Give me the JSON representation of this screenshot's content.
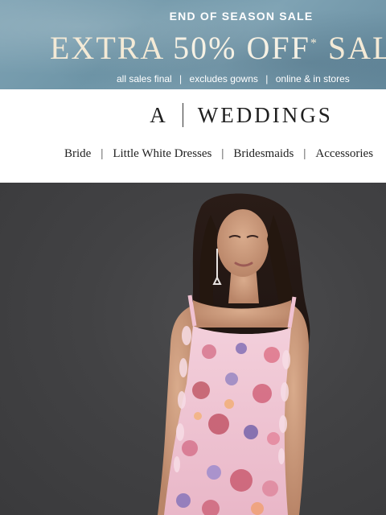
{
  "promo": {
    "eyebrow": "END OF SEASON SALE",
    "headline_pre": "EXTRA ",
    "headline_percent": "50% OFF",
    "headline_mark": "*",
    "headline_post": " SALE",
    "fineprint": [
      "all sales final",
      "excludes gowns",
      "online & in stores"
    ],
    "fineprint_separator": "|",
    "background_color": "#7fa3b4",
    "headline_color": "#f4ead6"
  },
  "header": {
    "logo_letter": "A",
    "logo_word": "WEDDINGS"
  },
  "nav": {
    "items": [
      "Bride",
      "Little White Dresses",
      "Bridesmaids",
      "Accessories"
    ],
    "separator": "|"
  },
  "hero": {
    "background_color": "#424244",
    "dress_color": "#f1c3d2"
  }
}
